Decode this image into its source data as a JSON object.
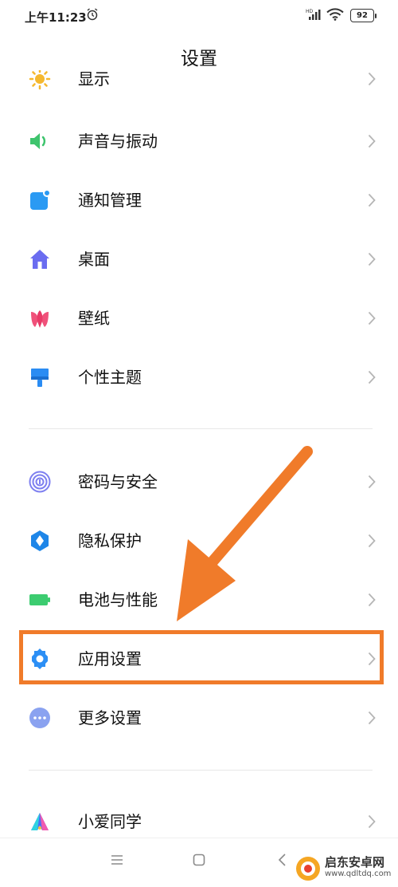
{
  "status_bar": {
    "time": "上午11:23",
    "battery": "92"
  },
  "page": {
    "title": "设置"
  },
  "items": [
    {
      "label": "显示",
      "icon": "sun-icon"
    },
    {
      "label": "声音与振动",
      "icon": "speaker-icon"
    },
    {
      "label": "通知管理",
      "icon": "notification-icon"
    },
    {
      "label": "桌面",
      "icon": "home-icon"
    },
    {
      "label": "壁纸",
      "icon": "tulip-icon"
    },
    {
      "label": "个性主题",
      "icon": "paintbrush-icon"
    },
    {
      "label": "密码与安全",
      "icon": "fingerprint-icon"
    },
    {
      "label": "隐私保护",
      "icon": "privacy-shield-icon"
    },
    {
      "label": "电池与性能",
      "icon": "battery-icon"
    },
    {
      "label": "应用设置",
      "icon": "gear-icon"
    },
    {
      "label": "更多设置",
      "icon": "more-dots-icon"
    },
    {
      "label": "小爱同学",
      "icon": "xiaoai-icon"
    }
  ],
  "watermark": {
    "title": "启东安卓网",
    "url": "www.qdltdq.com"
  },
  "colors": {
    "highlight": "#f07b2a",
    "speaker": "#3ec46d",
    "notification": "#2a9af3",
    "home": "#6a6cf0",
    "tulip": "#f0517a",
    "brush": "#2a8cf3",
    "fingerprint": "#7d7ff0",
    "privacy": "#1e86e8",
    "battery": "#3ccc70",
    "gear": "#2c8ff5",
    "more": "#8aa2f0"
  }
}
